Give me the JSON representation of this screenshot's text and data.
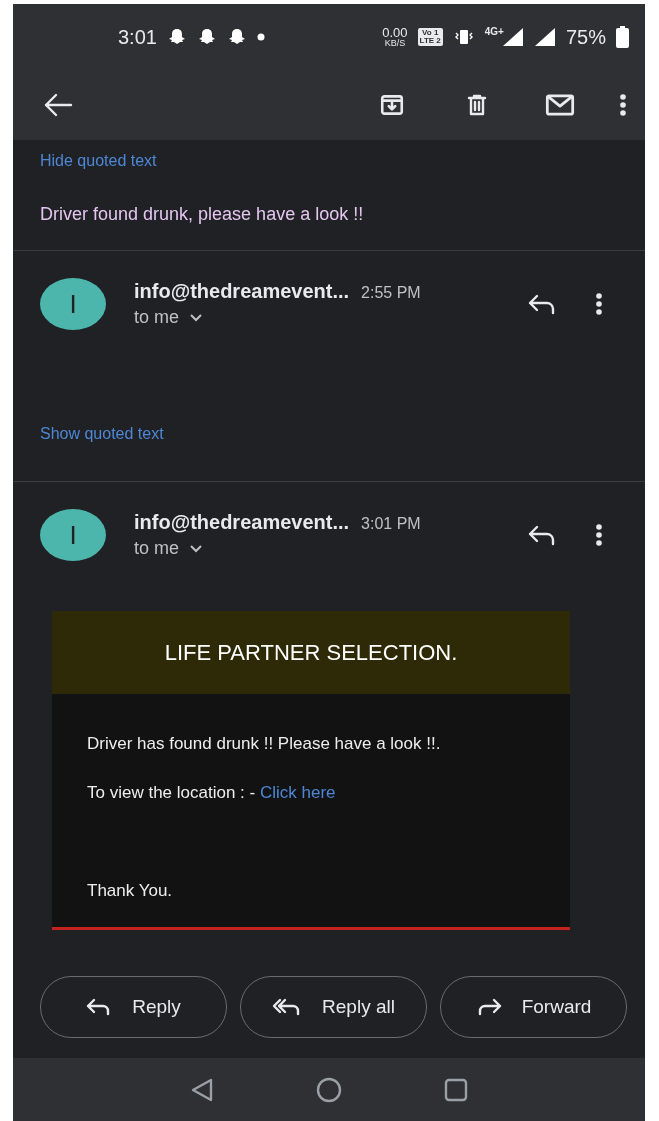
{
  "status_bar": {
    "time": "3:01",
    "data_speed": "0.00",
    "data_unit": "KB/S",
    "volte_top": "Vo 1",
    "volte_bottom": "LTE 2",
    "network": "4G+",
    "battery": "75%"
  },
  "toolbar": {
    "actions": [
      {
        "kind": "archive"
      },
      {
        "kind": "delete"
      },
      {
        "kind": "mark-unread"
      },
      {
        "kind": "more"
      }
    ]
  },
  "earlier_message": {
    "quoted_toggle": "Hide quoted text",
    "body": "Driver found drunk, please have a look !!"
  },
  "messages": [
    {
      "avatar_letter": "I",
      "sender": "info@thedreamevent...",
      "time": "2:55 PM",
      "recipient": "to me",
      "quoted_toggle": "Show quoted text"
    },
    {
      "avatar_letter": "I",
      "sender": "info@thedreamevent...",
      "time": "3:01 PM",
      "recipient": "to me",
      "card": {
        "title": "LIFE PARTNER SELECTION.",
        "lines": [
          "Driver has found drunk !! Please have a look !!."
        ],
        "location_label": "To view the location : -",
        "link": "Click here",
        "closing": "Thank You."
      }
    }
  ],
  "actions": [
    {
      "kind": "reply",
      "label": "Reply"
    },
    {
      "kind": "reply-all",
      "label": "Reply all"
    },
    {
      "kind": "forward",
      "label": "Forward"
    }
  ],
  "nav_bar": {
    "buttons": [
      {
        "kind": "back"
      },
      {
        "kind": "home"
      },
      {
        "kind": "recents"
      }
    ]
  }
}
